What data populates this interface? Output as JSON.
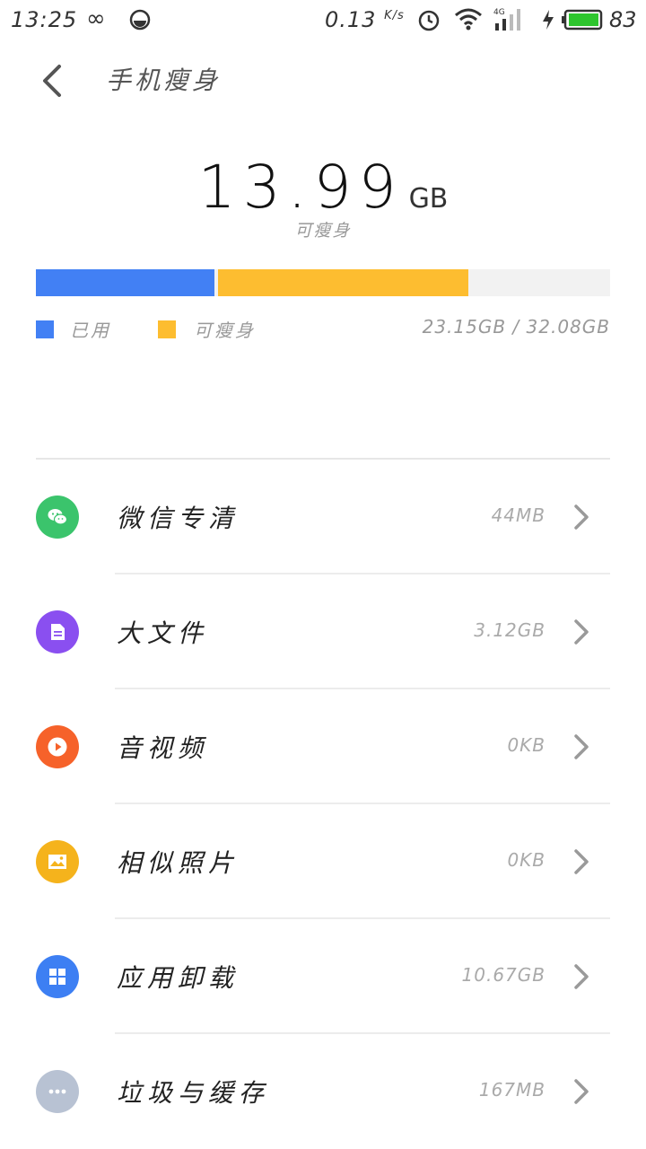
{
  "status_bar": {
    "time": "13:25",
    "net_speed": "0.13",
    "net_unit": "K/s",
    "signal_type": "4G",
    "battery_level": "83"
  },
  "header": {
    "title": "手机瘦身"
  },
  "summary": {
    "slimmable_value": "13.99",
    "slimmable_unit": "GB",
    "slimmable_label": "可瘦身"
  },
  "storage_bar": {
    "used_fraction": 0.311,
    "slimmable_fraction": 0.436,
    "used_color": "#4280f4",
    "slimmable_color": "#fdbd30"
  },
  "legend": {
    "used_label": "已用",
    "slimmable_label": "可瘦身",
    "total_text": "23.15GB / 32.08GB"
  },
  "items": [
    {
      "name": "微信专清",
      "size": "44MB",
      "icon": "wechat-icon",
      "color": "#3bc46c"
    },
    {
      "name": "大文件",
      "size": "3.12GB",
      "icon": "document-icon",
      "color": "#8a4ff0"
    },
    {
      "name": "音视频",
      "size": "0KB",
      "icon": "play-icon",
      "color": "#f6622a"
    },
    {
      "name": "相似照片",
      "size": "0KB",
      "icon": "photo-icon",
      "color": "#f5b31c"
    },
    {
      "name": "应用卸载",
      "size": "10.67GB",
      "icon": "apps-grid-icon",
      "color": "#3d7ff3"
    },
    {
      "name": "垃圾与缓存",
      "size": "167MB",
      "icon": "more-dots-icon",
      "color": "#b8c2d3"
    }
  ]
}
